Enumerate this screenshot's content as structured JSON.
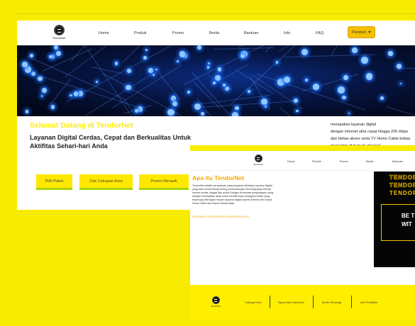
{
  "brand": {
    "name": "TendorNet"
  },
  "nav": {
    "links": [
      "Home",
      "Produk",
      "Promo",
      "Berita",
      "Bantuan",
      "Info",
      "FAQ"
    ],
    "cta_label": "Pembeli"
  },
  "hero": {
    "welcome": "Selamat Datang di TendorNet",
    "tagline": "Layanan Digital Cerdas, Cepat dan Berkualitas Untuk Aktifitas Sehari-hari Anda"
  },
  "buttons": [
    "Pilih Paket",
    "Cek Cakupan Area",
    "Promo Menarik"
  ],
  "description_lines": [
    "merupakan layanan digital",
    "dengan internet ultra cepat hingga 200 mbps",
    "dan bebas akses serta TV Home Cable bebas",
    "menonton di banyak channel"
  ],
  "front": {
    "nav_links": [
      "Home",
      "Produk",
      "Promo",
      "Berita",
      "Bantuan"
    ],
    "title": "Apa itu TendorNet",
    "body": "TendorNet adalah perusahaan yang bergerak dibidang Layanan Digital yang akan berkembang seiring perkembangan teknologi yang bekerja secara cerdas, tinggal dan pintar Dengan berinovasi penghargaan yang didapat memastikan anda untuk memilih kami sebagai provider yang terpercaya Beragam macam layanan digital seperti internet ultra cepat, Home Cable dan Report bebas biaya.",
    "link": "INFORMASI SELENGKAPNYA MENGENAI KAMI",
    "banner_lines": [
      "TENDOR",
      "TENDOR",
      "TENDOR"
    ],
    "banner_box_lines": [
      "BE T",
      "WIT"
    ],
    "footer_items": [
      "Hubungi Kami",
      "Syarat dan Ketentuan",
      "Berita Teknologi",
      "Info Pendaftar"
    ]
  }
}
